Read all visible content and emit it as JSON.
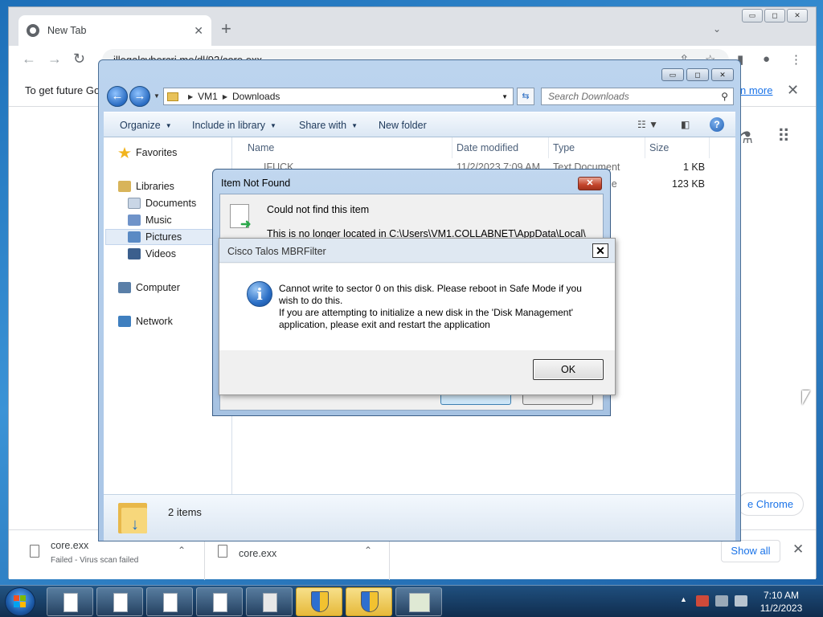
{
  "chrome": {
    "tab_title": "New Tab",
    "tab_close": "✕",
    "new_tab": "+",
    "tab_search": "⌄",
    "window_controls": [
      "▭",
      "◻",
      "✕"
    ],
    "back": "←",
    "forward": "→",
    "reload": "↻",
    "url": "illegalcybercri.me/dl/92/core.exx",
    "share_icon": "⇪",
    "star_icon": "☆",
    "sidepanel_icon": "▮",
    "profile_icon": "●",
    "menu_icon": "⋮",
    "infobar_text": "To get future Go",
    "infobar_link": "n more",
    "infobar_close": "✕",
    "labs_icon": "⚗",
    "apps_icon": "⠿",
    "pill_text": "e Chrome"
  },
  "downloads": {
    "items": [
      {
        "name": "core.exx",
        "status": "Failed - Virus scan failed",
        "chevron": "⌃"
      },
      {
        "name": "core.exx",
        "status": "",
        "chevron": "⌃"
      }
    ],
    "show_all": "Show all",
    "close": "✕"
  },
  "explorer": {
    "window_controls": [
      "▭",
      "◻",
      "✕"
    ],
    "breadcrumb": [
      "VM1",
      "Downloads"
    ],
    "search_placeholder": "Search Downloads",
    "toolbar": {
      "organize": "Organize",
      "include_in_library": "Include in library",
      "share_with": "Share with",
      "new_folder": "New folder"
    },
    "sidebar": [
      {
        "label": "Favorites",
        "icon": "star",
        "color": "#f1b31c"
      },
      {
        "label": "Libraries",
        "icon": "libraries",
        "color": "#d8b45a"
      },
      {
        "label": "Documents",
        "icon": "documents",
        "color": "#c9d6e6"
      },
      {
        "label": "Music",
        "icon": "music",
        "color": "#6f93c9"
      },
      {
        "label": "Pictures",
        "icon": "pictures",
        "color": "#5a8ac4"
      },
      {
        "label": "Videos",
        "icon": "videos",
        "color": "#3b5f8d"
      },
      {
        "label": "Computer",
        "icon": "computer",
        "color": "#5a7fa8"
      },
      {
        "label": "Network",
        "icon": "network",
        "color": "#3f7fbf"
      }
    ],
    "columns": [
      "Name",
      "Date modified",
      "Type",
      "Size"
    ],
    "rows": [
      {
        "name": "IFUCK",
        "date": "11/2/2023 7:09 AM",
        "type": "Text Document",
        "size": "1 KB"
      },
      {
        "name": "",
        "date": "",
        "type": "le",
        "size": "123 KB"
      }
    ],
    "status": "2 items"
  },
  "item_not_found": {
    "title": "Item Not Found",
    "close": "✕",
    "heading": "Could not find this item",
    "path_text": "This is no longer located in C:\\Users\\VM1.COLLABNET\\AppData\\Local\\"
  },
  "talos": {
    "title": "Cisco Talos MBRFilter",
    "close": "✕",
    "message": "Cannot write to sector 0 on this disk. Please reboot in Safe Mode if you\nwish to do this.\nIf you are attempting to initialize a new disk in the 'Disk Management'\napplication, please exit and restart the application",
    "ok": "OK",
    "info_glyph": "i"
  },
  "taskbar": {
    "tray_arrow": "▲",
    "time": "7:10 AM",
    "date": "11/2/2023"
  }
}
